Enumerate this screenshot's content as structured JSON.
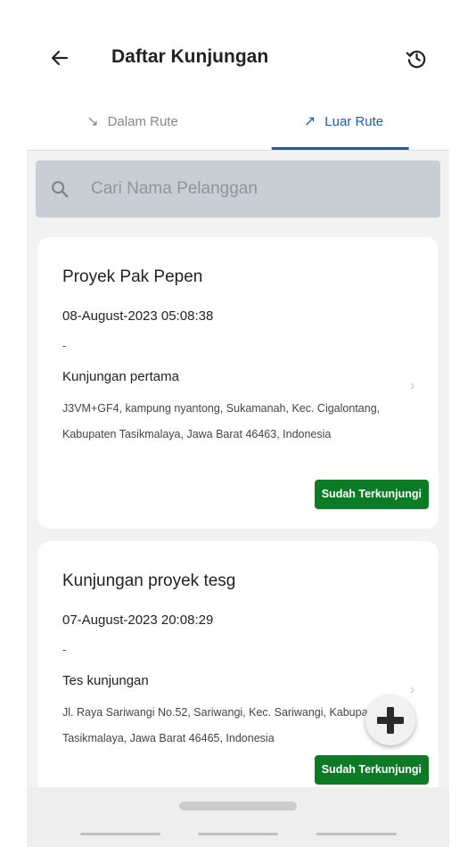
{
  "header": {
    "title": "Daftar Kunjungan",
    "back_icon": "arrow-left-icon",
    "history_icon": "history-icon"
  },
  "tabs": [
    {
      "label": "Dalam Rute",
      "icon": "↘",
      "active": false
    },
    {
      "label": "Luar Rute",
      "icon": "↗",
      "active": true
    }
  ],
  "search": {
    "placeholder": "Cari Nama Pelanggan"
  },
  "visits": [
    {
      "name": "Proyek Pak Pepen",
      "datetime": "08-August-2023 05:08:38",
      "note": "-",
      "type": "Kunjungan pertama",
      "address": "J3VM+GF4, kampung nyantong, Sukamanah, Kec. Cigalontang, Kabupaten Tasikmalaya, Jawa Barat 46463, Indonesia",
      "status": "Sudah Terkunjungi",
      "chevron": "›"
    },
    {
      "name": "Kunjungan proyek tesg",
      "datetime": "07-August-2023 20:08:29",
      "note": "-",
      "type": "Tes kunjungan",
      "address": "Jl. Raya Sariwangi No.52, Sariwangi, Kec. Sariwangi, Kabupaten Tasikmalaya, Jawa Barat 46465, Indonesia",
      "status": "Sudah Terkunjungi",
      "chevron": "›"
    }
  ],
  "colors": {
    "accent": "#1c5fa8",
    "status_green": "#0d7a25",
    "search_bg": "#c9ced4"
  },
  "fab": {
    "icon": "plus-icon"
  }
}
